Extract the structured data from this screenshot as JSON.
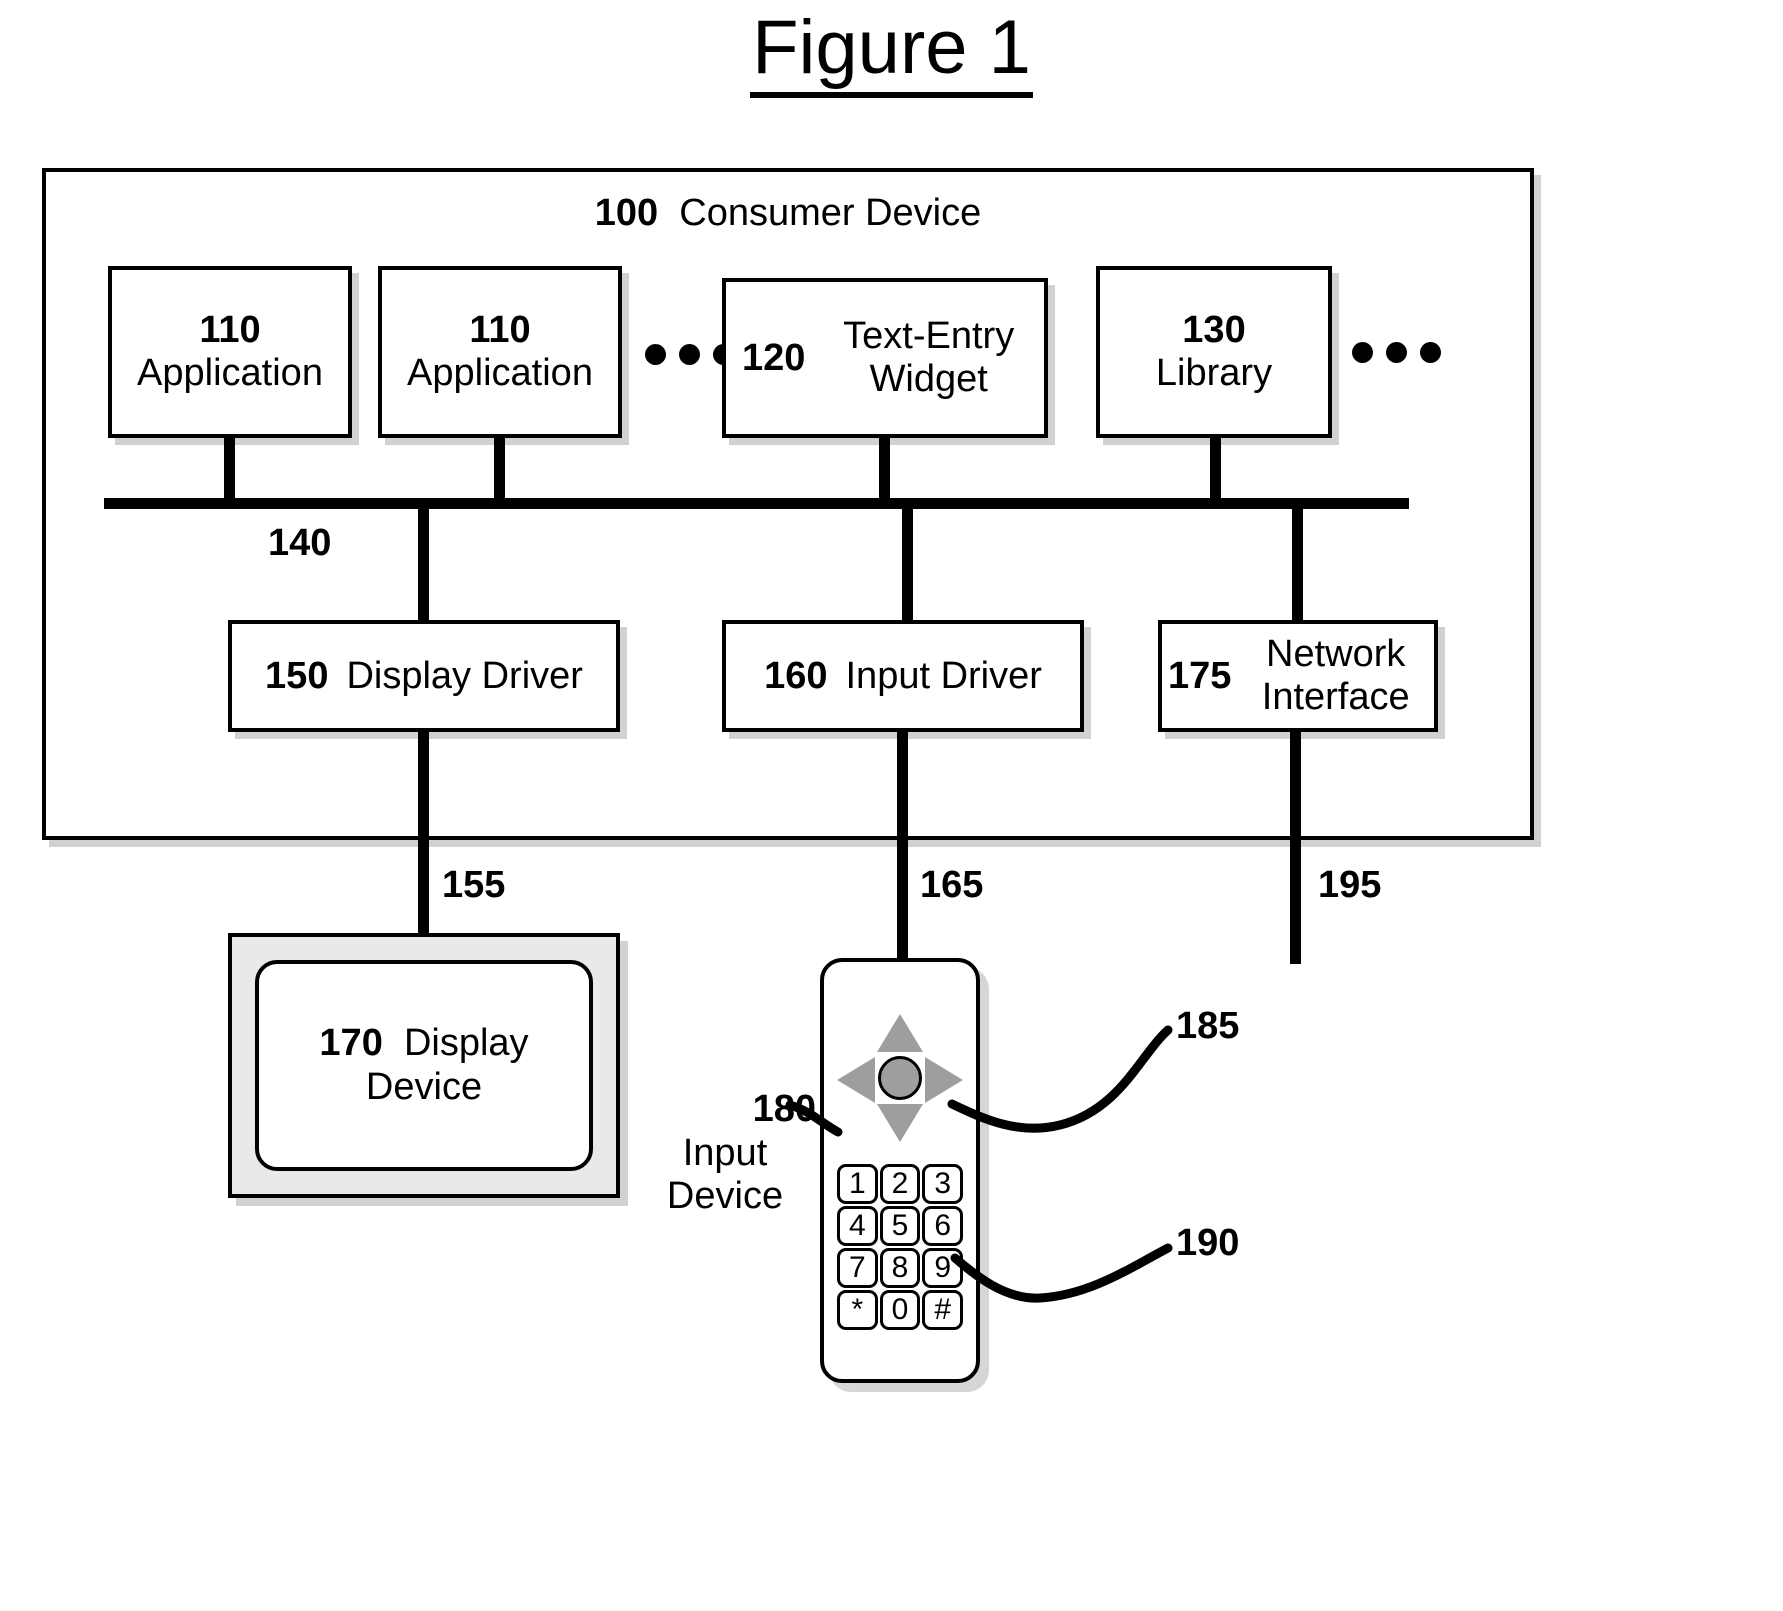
{
  "figure": {
    "title": "Figure 1"
  },
  "consumer_device": {
    "ref": "100",
    "label": "Consumer Device"
  },
  "top_row": {
    "blocks": [
      {
        "ref": "110",
        "label": "Application"
      },
      {
        "ref": "110",
        "label": "Application"
      },
      {
        "ref": "120",
        "label": "Text-Entry Widget"
      },
      {
        "ref": "130",
        "label": "Library"
      }
    ],
    "ellipsis_1": "•••",
    "ellipsis_2": "•••"
  },
  "bus": {
    "ref": "140"
  },
  "driver_row": {
    "blocks": [
      {
        "ref": "150",
        "label": "Display Driver"
      },
      {
        "ref": "160",
        "label": "Input Driver"
      },
      {
        "ref": "175",
        "label": "Network Interface"
      }
    ]
  },
  "links": {
    "display_link": "155",
    "input_link": "165",
    "network_link": "195"
  },
  "display_device": {
    "ref": "170",
    "label": "Display Device"
  },
  "input_device": {
    "ref": "180",
    "label": "Input Device",
    "dpad_ref": "185",
    "keypad_ref": "190",
    "keys": [
      "1",
      "2",
      "3",
      "4",
      "5",
      "6",
      "7",
      "8",
      "9",
      "*",
      "0",
      "#"
    ]
  }
}
